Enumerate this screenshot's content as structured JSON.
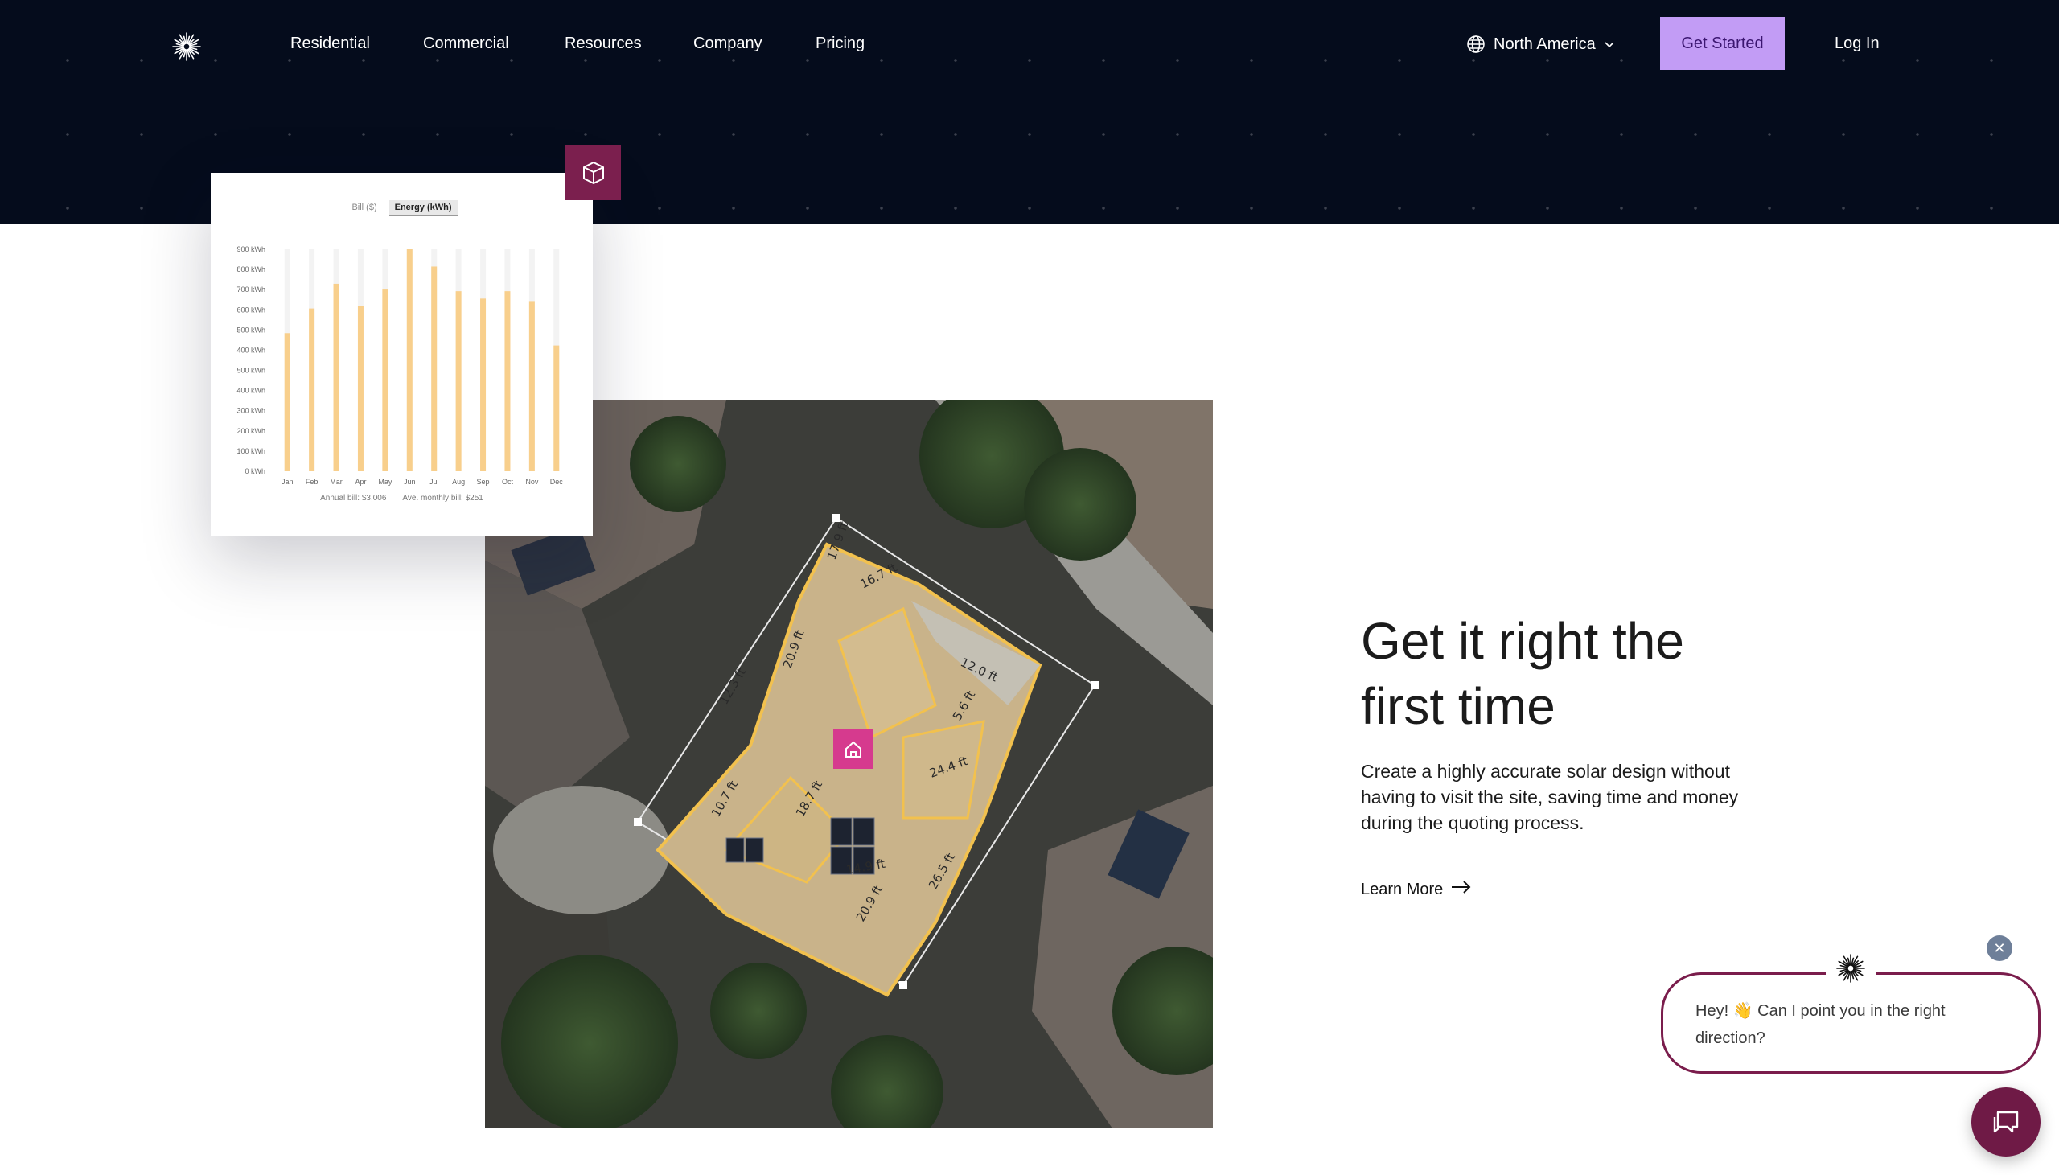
{
  "nav": {
    "logo_icon": "sunburst-logo-icon",
    "links": [
      "Residential",
      "Commercial",
      "Resources",
      "Company",
      "Pricing"
    ],
    "region": "North America",
    "get_started": "Get Started",
    "login": "Log In"
  },
  "chart_card": {
    "toggle": [
      "Bill ($)",
      "Energy (kWh)"
    ],
    "active_toggle": "Energy (kWh)",
    "footer": [
      "Annual bill: $3,006",
      "Ave. monthly bill: $251"
    ]
  },
  "chart_data": {
    "type": "bar",
    "categories": [
      "Jan",
      "Feb",
      "Mar",
      "Apr",
      "May",
      "Jun",
      "Jul",
      "Aug",
      "Sep",
      "Oct",
      "Nov",
      "Dec"
    ],
    "values": [
      560,
      660,
      760,
      670,
      740,
      900,
      830,
      730,
      700,
      730,
      690,
      510
    ],
    "y_tick_labels": [
      "0 kWh",
      "100 kWh",
      "200 kWh",
      "300 kWh",
      "400 kWh",
      "500 kWh",
      "400 kWh",
      "500 kWh",
      "600 kWh",
      "700 kWh",
      "800 kWh",
      "900 kWh"
    ],
    "ylim": [
      0,
      900
    ],
    "title": "",
    "xlabel": "",
    "ylabel": "",
    "bar_color": "#f8cf8c",
    "track_color": "#f3f3f3"
  },
  "badges": {
    "cube_icon": "cube-icon",
    "home_icon": "home-icon"
  },
  "aerial_labels": [
    "16.7 ft",
    "17.9 ft",
    "12.0 ft",
    "20.9 ft",
    "24.4 ft",
    "12.3 ft",
    "18.7 ft",
    "14.9 ft",
    "10.7 ft",
    "20.9 ft",
    "5.6 ft",
    "26.5 ft"
  ],
  "hero": {
    "title_line1": "Get it right the",
    "title_line2": "first time",
    "subtitle": "Create a highly accurate solar design without having to visit the site, saving time and money during the quoting process.",
    "learn_more": "Learn More"
  },
  "chat": {
    "message": "Hey! 👋 Can I point you in the right direction?",
    "close_icon": "close-icon",
    "launcher_icon": "chat-bubbles-icon"
  },
  "colors": {
    "header_bg": "#050c1c",
    "accent_purple": "#c29cf5",
    "brand_maroon": "#7a1d4c",
    "highlight_pink": "#d63a8e",
    "roof_outline": "#f2c14e"
  }
}
